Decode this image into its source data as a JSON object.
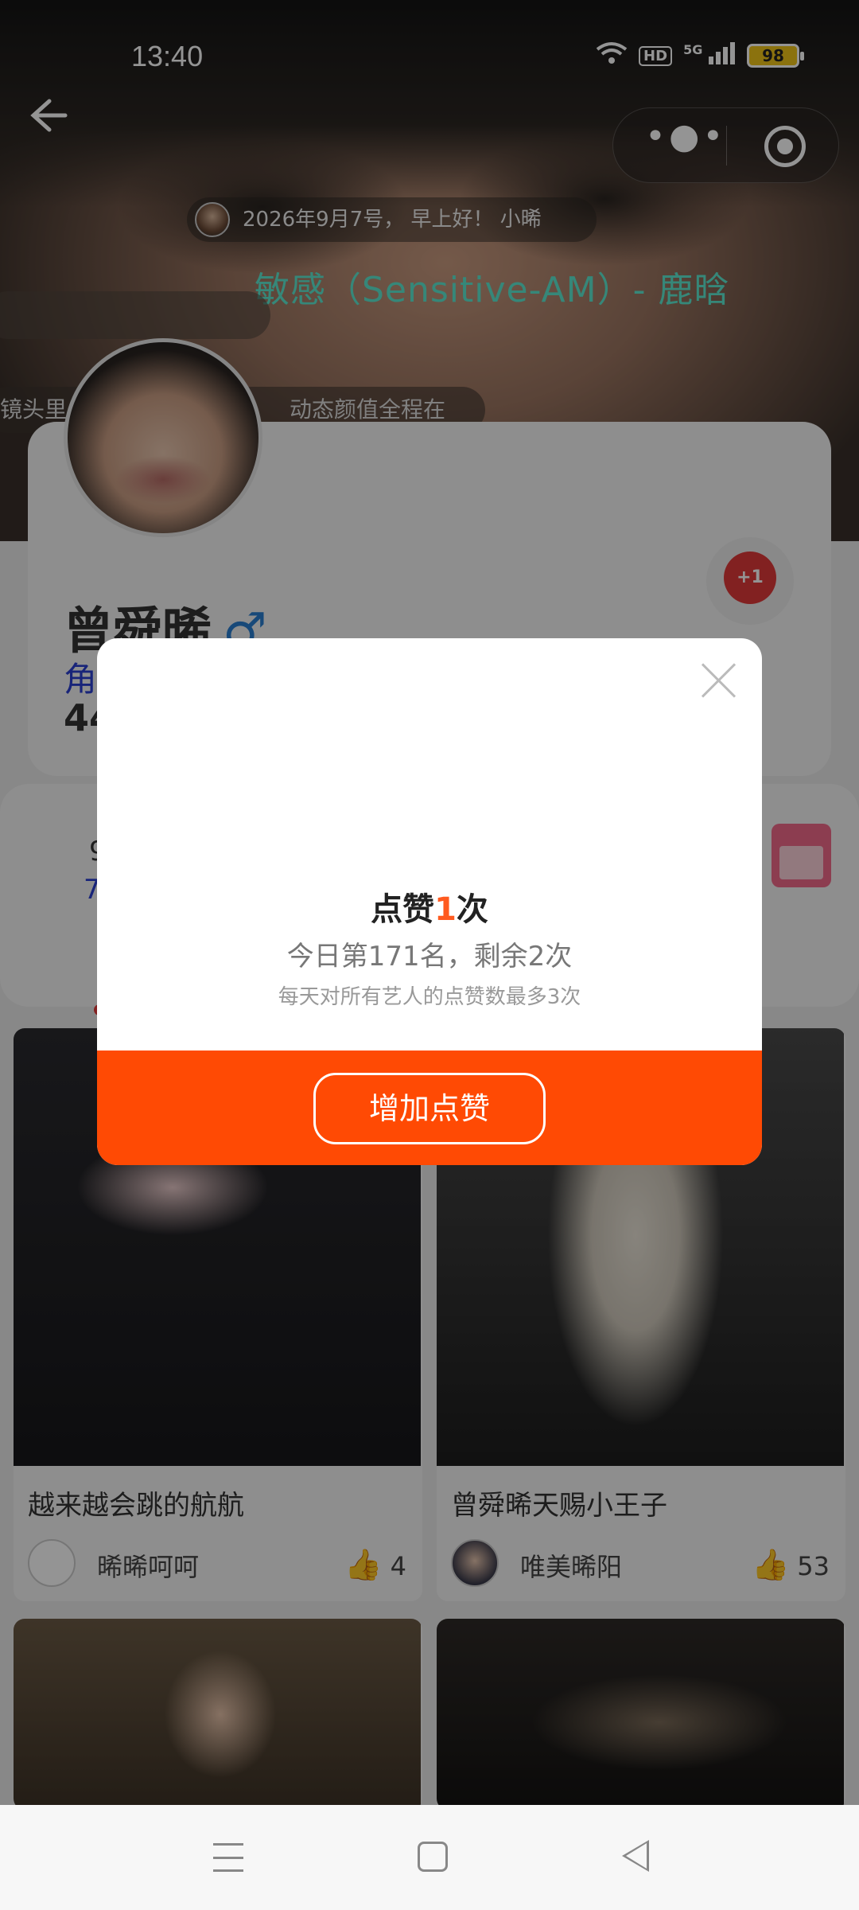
{
  "status_bar": {
    "time": "13:40",
    "network": "5G",
    "hd": "HD",
    "battery": "98"
  },
  "header": {
    "greeting": "2026年9月7号， 早上好！ 小晞",
    "song": "敏感（Sensitive-AM）- 鹿晗",
    "danmu": [
      "",
      "镜头里",
      "动态颜值全程在"
    ]
  },
  "profile": {
    "name": "曾舜晞",
    "gender_symbol": "♂",
    "role_prefix": "角",
    "number_prefix": "44",
    "like_badge": "+1"
  },
  "stats": {
    "row1": "9",
    "row2": "7"
  },
  "feed": [
    {
      "title": "越来越会跳的航航",
      "author": "晞晞呵呵",
      "likes": "4"
    },
    {
      "title": "曾舜晞天赐小王子",
      "author": "唯美晞阳",
      "likes": "53"
    }
  ],
  "dialog": {
    "title_prefix": "点赞",
    "title_count": "1",
    "title_suffix": "次",
    "rank_text": "今日第171名，剩余2次",
    "note_text": "每天对所有艺人的点赞数最多3次",
    "button_label": "增加点赞"
  },
  "icons": {
    "back": "back-arrow-icon",
    "more": "more-dots-icon",
    "target": "target-icon",
    "heart": "heart-icon",
    "calendar": "calendar-icon",
    "thumb": "thumb-up-icon",
    "close": "close-icon"
  },
  "colors": {
    "accent": "#ff4a04",
    "count_highlight": "#ff5a1f",
    "song_title": "#5de8d0",
    "role_text": "#2a3fd1"
  }
}
